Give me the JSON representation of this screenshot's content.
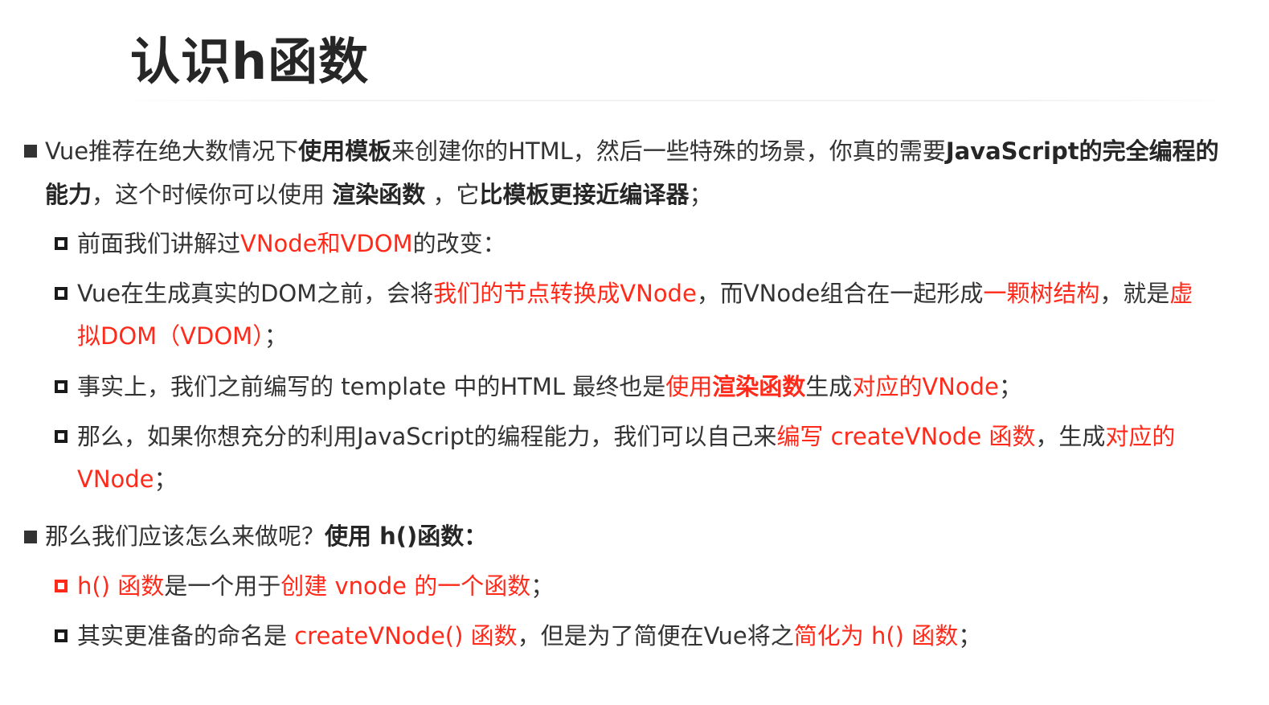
{
  "title": "认识h函数",
  "p1": {
    "line1": [
      {
        "text": "Vue推荐在绝大数情况下",
        "style": "n"
      },
      {
        "text": "使用模板",
        "style": "b"
      },
      {
        "text": "来创建你的HTML，然后一些特殊的场景，你真的需要",
        "style": "n"
      },
      {
        "text": "JavaScript的完全编程的",
        "style": "b"
      }
    ],
    "line2": [
      {
        "text": "能力",
        "style": "b"
      },
      {
        "text": "，这个时候你可以使用 ",
        "style": "n"
      },
      {
        "text": "渲染函数",
        "style": "b"
      },
      {
        "text": " ，它",
        "style": "n"
      },
      {
        "text": "比模板更接近编译器",
        "style": "b"
      },
      {
        "text": "；",
        "style": "n"
      }
    ]
  },
  "s1": [
    {
      "text": "前面我们讲解过",
      "style": "n"
    },
    {
      "text": "VNode和VDOM",
      "style": "r"
    },
    {
      "text": "的改变：",
      "style": "n"
    }
  ],
  "s2": {
    "line1": [
      {
        "text": "Vue在生成真实的DOM之前，会将",
        "style": "n"
      },
      {
        "text": "我们的节点转换成VNode",
        "style": "r"
      },
      {
        "text": "，而VNode组合在一起形成",
        "style": "n"
      },
      {
        "text": "一颗树结构",
        "style": "r"
      },
      {
        "text": "，就是",
        "style": "n"
      },
      {
        "text": "虚",
        "style": "r"
      }
    ],
    "line2": [
      {
        "text": "拟DOM（VDOM）",
        "style": "r"
      },
      {
        "text": "；",
        "style": "n"
      }
    ]
  },
  "s3": [
    {
      "text": "事实上，我们之前编写的 template 中的HTML 最终也是",
      "style": "n"
    },
    {
      "text": "使用",
      "style": "r"
    },
    {
      "text": "渲染函数",
      "style": "rb"
    },
    {
      "text": "生成",
      "style": "n"
    },
    {
      "text": "对应的VNode",
      "style": "r"
    },
    {
      "text": "；",
      "style": "n"
    }
  ],
  "s4": {
    "line1": [
      {
        "text": "那么，如果你想充分的利用JavaScript的编程能力，我们可以自己来",
        "style": "n"
      },
      {
        "text": "编写 createVNode 函数",
        "style": "r"
      },
      {
        "text": "，生成",
        "style": "n"
      },
      {
        "text": "对应的",
        "style": "r"
      }
    ],
    "line2": [
      {
        "text": "VNode",
        "style": "r"
      },
      {
        "text": "；",
        "style": "n"
      }
    ]
  },
  "p2": [
    {
      "text": "那么我们应该怎么来做呢？",
      "style": "n"
    },
    {
      "text": "使用 h()函数：",
      "style": "b"
    }
  ],
  "s5": [
    {
      "text": "h() 函数",
      "style": "r"
    },
    {
      "text": "是一个用于",
      "style": "n"
    },
    {
      "text": "创建 vnode 的一个函数",
      "style": "r"
    },
    {
      "text": "；",
      "style": "n"
    }
  ],
  "s6": [
    {
      "text": "其实更准备的命名是 ",
      "style": "n"
    },
    {
      "text": "createVNode() 函数",
      "style": "r"
    },
    {
      "text": "，但是为了简便在Vue将之",
      "style": "n"
    },
    {
      "text": "简化为 h() 函数",
      "style": "r"
    },
    {
      "text": "；",
      "style": "n"
    }
  ],
  "colors": {
    "accent_red": "#ff2a1a",
    "text": "#333333",
    "bold_text": "#262626"
  }
}
